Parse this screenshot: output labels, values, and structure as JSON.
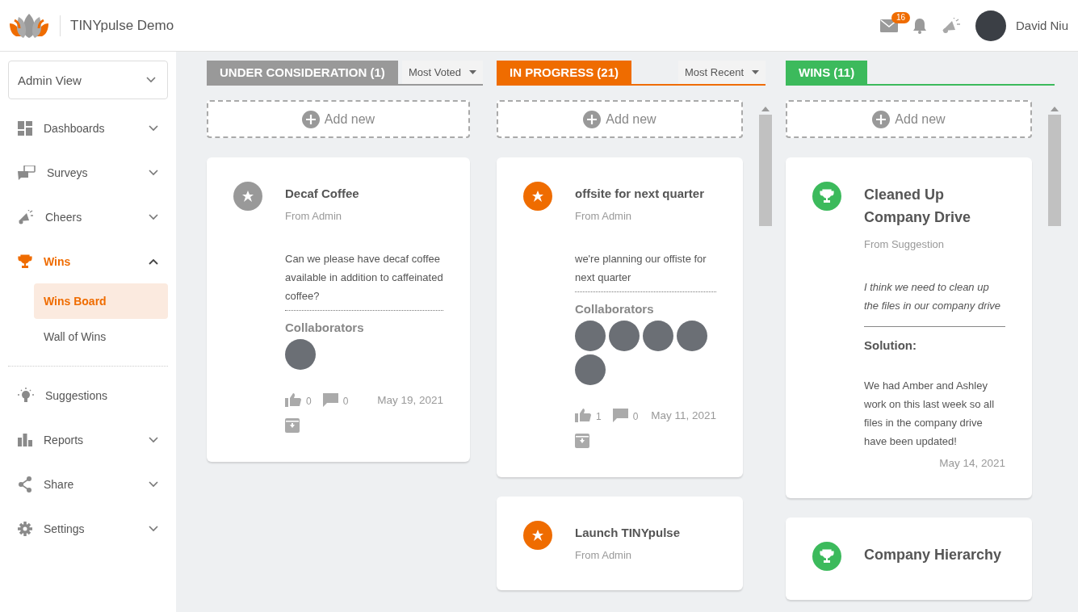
{
  "header": {
    "title": "TINYpulse Demo",
    "mail_badge": "16",
    "user_name": "David Niu"
  },
  "sidebar": {
    "view_select": "Admin View",
    "nav_groups": [
      [
        {
          "label": "Dashboards",
          "selected": false,
          "expanded": false
        },
        {
          "label": "Surveys",
          "selected": false,
          "expanded": false
        },
        {
          "label": "Cheers",
          "selected": false,
          "expanded": false
        },
        {
          "label": "Wins",
          "selected": true,
          "expanded": true,
          "children": [
            {
              "label": "Wins Board",
              "selected": true
            },
            {
              "label": "Wall of Wins",
              "selected": false
            }
          ]
        }
      ],
      [
        {
          "label": "Suggestions",
          "selected": false
        },
        {
          "label": "Reports",
          "selected": false,
          "expanded": false
        },
        {
          "label": "Share",
          "selected": false,
          "expanded": false
        },
        {
          "label": "Settings",
          "selected": false,
          "expanded": false
        }
      ]
    ]
  },
  "columns": [
    {
      "title": "UNDER CONSIDERATION (1)",
      "color": "#999999",
      "sort": "Most Voted",
      "scrollable": false,
      "add_label": "Add new",
      "cards": [
        {
          "kind": "idea",
          "color": "#999999",
          "title": "Decaf Coffee",
          "source": "From Admin",
          "body": "Can we please have decaf coffee available in addition to caffeinated coffee?",
          "collaborators_label": "Collaborators",
          "avatars": [
            {
              "kind": "photo"
            }
          ],
          "likes": "0",
          "comments": "0",
          "date": "May 19, 2021"
        }
      ]
    },
    {
      "title": "IN PROGRESS (21)",
      "color": "#ef6c00",
      "sort": "Most Recent",
      "scrollable": true,
      "add_label": "Add new",
      "cards": [
        {
          "kind": "idea",
          "color": "#ef6c00",
          "title": "offsite for next quarter",
          "source": "From Admin",
          "body": "we're planning our offiste for next quarter",
          "collaborators_label": "Collaborators",
          "avatars": [
            {
              "kind": "photo"
            },
            {
              "kind": "photo"
            },
            {
              "kind": "photo"
            },
            {
              "kind": "photo"
            },
            {
              "kind": "photo"
            }
          ],
          "likes": "1",
          "comments": "0",
          "date": "May 11, 2021"
        },
        {
          "kind": "idea",
          "color": "#ef6c00",
          "title": "Launch TINYpulse",
          "source": "From Admin"
        }
      ]
    },
    {
      "title": "WINS (11)",
      "color": "#3cba5c",
      "scrollable": true,
      "add_label": "Add new",
      "cards": [
        {
          "kind": "win",
          "color": "#3cba5c",
          "title": "Cleaned Up Company Drive",
          "source": "From Suggestion",
          "body": "I think we need to clean up the files in our company drive",
          "solution_label": "Solution:",
          "solution": "We had Amber and Ashley work on this last week so all files in the company drive have been updated!",
          "date": "May 14, 2021"
        },
        {
          "kind": "win",
          "color": "#3cba5c",
          "title": "Company Hierarchy"
        }
      ]
    }
  ]
}
